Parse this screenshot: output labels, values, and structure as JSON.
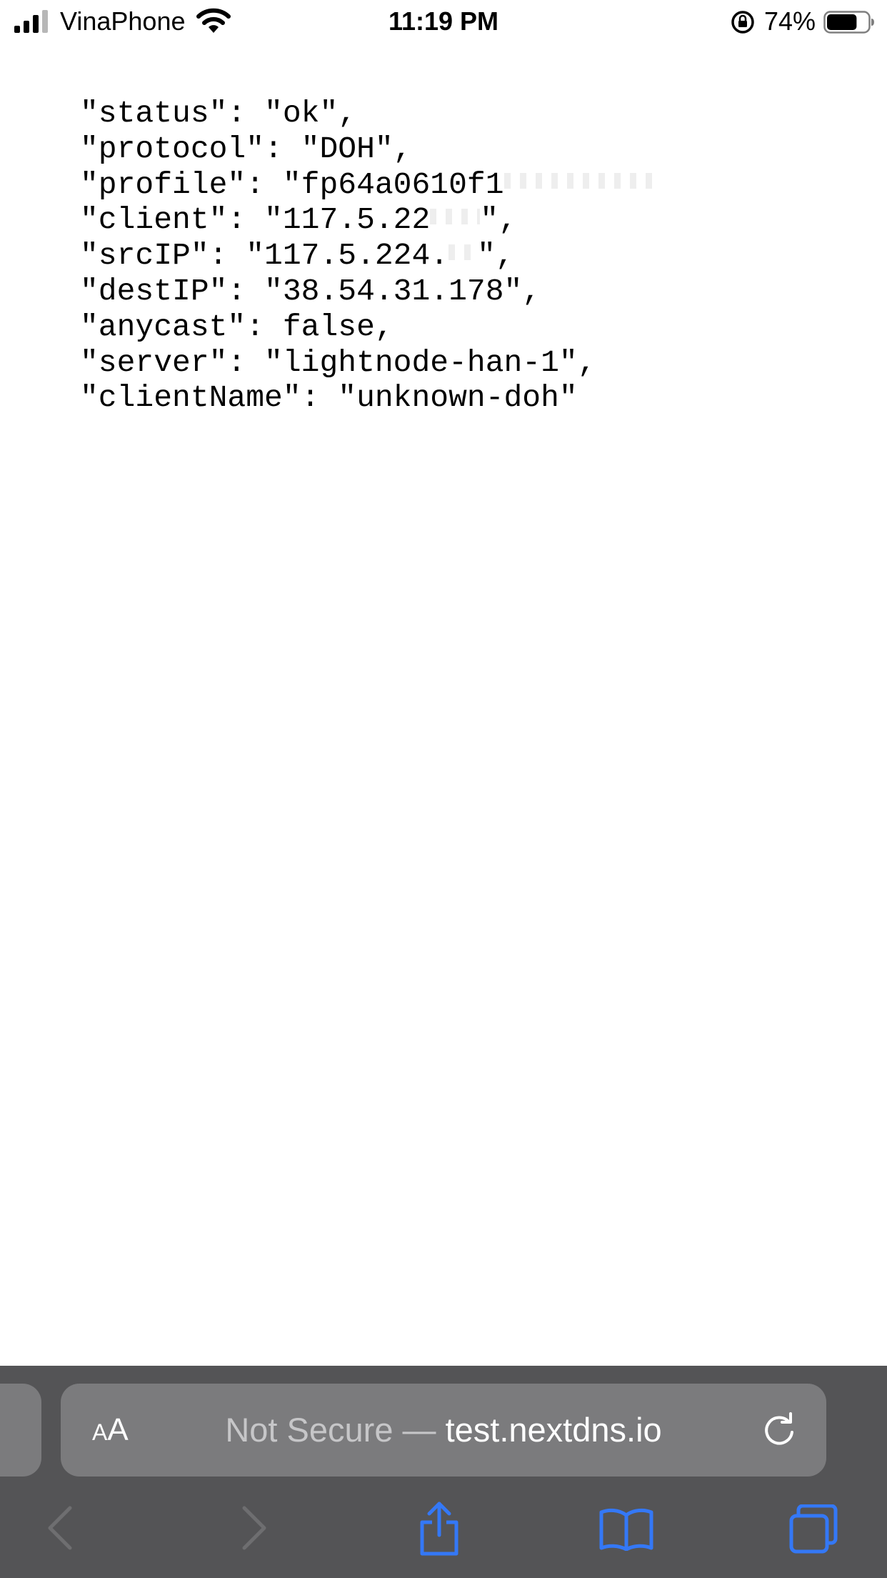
{
  "status_bar": {
    "carrier": "VinaPhone",
    "time": "11:19 PM",
    "battery_percent": "74%",
    "battery_level": 0.74
  },
  "json_lines": [
    {
      "text": "\"status\": \"ok\","
    },
    {
      "text": "\"protocol\": \"DOH\","
    },
    {
      "text": "\"profile\": \"fp64a0610f1",
      "redacted": true
    },
    {
      "text": "\"client\": \"117.5.22",
      "redacted": true,
      "suffix": "\","
    },
    {
      "text": "\"srcIP\": \"117.5.224.",
      "redacted": true,
      "suffix": "\","
    },
    {
      "text": "\"destIP\": \"38.54.31.178\","
    },
    {
      "text": "\"anycast\": false,"
    },
    {
      "text": "\"server\": \"lightnode-han-1\","
    },
    {
      "text": "\"clientName\": \"unknown-doh\""
    }
  ],
  "safari": {
    "aa_small": "A",
    "aa_large": "A",
    "url_prefix": "Not Secure — ",
    "url_domain": "test.nextdns.io",
    "accent_color": "#3478f6"
  },
  "icons": {
    "reload": "reload-icon",
    "back": "chevron-left-icon",
    "forward": "chevron-right-icon",
    "share": "share-icon",
    "bookmarks": "book-icon",
    "tabs": "tabs-icon"
  }
}
